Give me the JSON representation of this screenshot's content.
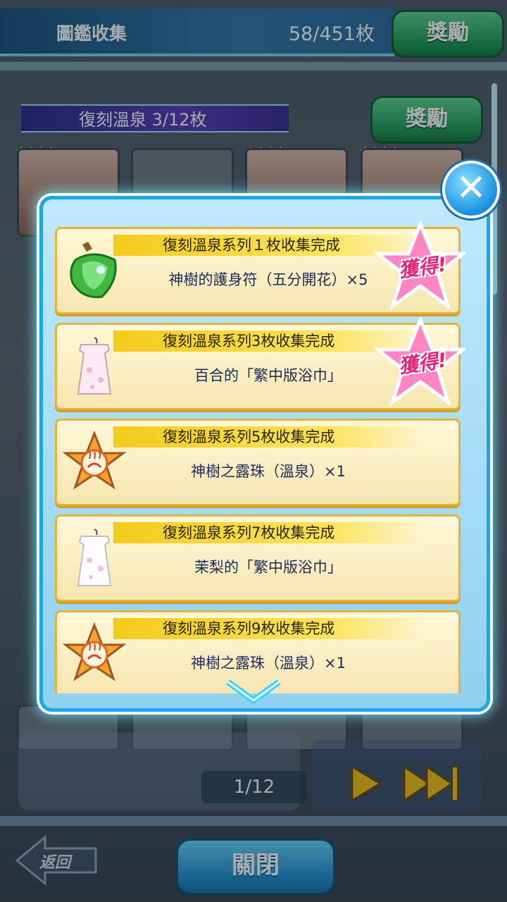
{
  "header": {
    "title": "圖鑑收集",
    "count": "58/451枚",
    "reward_label": "獎勵"
  },
  "series": {
    "name": "復刻溫泉 3/12枚",
    "reward_label": "獎勵",
    "stars": "★★★★"
  },
  "popup": {
    "close_symbol": "✕",
    "obtained_label": "獲得!",
    "items": [
      {
        "title": "復刻溫泉系列１枚收集完成",
        "reward": "神樹的護身符（五分開花）×5",
        "icon": "amulet-icon",
        "obtained": true
      },
      {
        "title": "復刻溫泉系列3枚收集完成",
        "reward": "百合的「繁中版浴巾」",
        "icon": "towel-dress-icon",
        "obtained": true
      },
      {
        "title": "復刻溫泉系列5枚收集完成",
        "reward": "神樹之露珠（溫泉）×1",
        "icon": "onsen-medal-icon",
        "obtained": false
      },
      {
        "title": "復刻溫泉系列7枚收集完成",
        "reward": "茉梨的「繁中版浴巾」",
        "icon": "towel-dress-icon",
        "obtained": false
      },
      {
        "title": "復刻溫泉系列9枚收集完成",
        "reward": "神樹之露珠（溫泉）×1",
        "icon": "onsen-medal-icon",
        "obtained": false
      }
    ]
  },
  "footer": {
    "page": "1/12",
    "back_label": "返回",
    "close_label": "關閉"
  },
  "colors": {
    "modal_border": "#1ea7e8",
    "item_border": "#e7b23a",
    "obtained_pink": "#e0247a",
    "green_button": "#219a53"
  }
}
